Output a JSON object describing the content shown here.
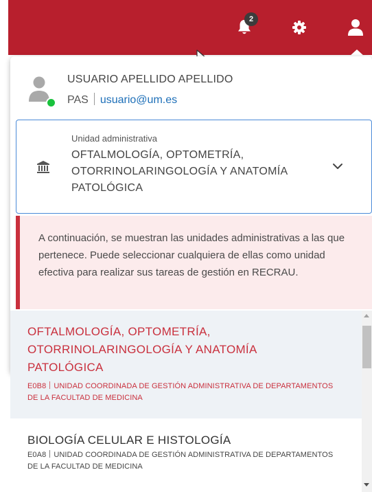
{
  "topbar": {
    "color": "#b81f2d",
    "notifications": {
      "icon": "bell-icon",
      "count": "2"
    },
    "settings": {
      "icon": "gear-icon"
    },
    "user": {
      "icon": "user-icon"
    }
  },
  "user": {
    "name": "USUARIO APELLIDO APELLIDO",
    "role": "PAS",
    "email": "usuario@um.es",
    "status_color": "#19c23d"
  },
  "unit_select": {
    "label": "Unidad administrativa",
    "value": "OFTALMOLOGÍA, OPTOMETRÍA, OTORRINOLARINGOLOGÍA Y ANATOMÍA PATOLÓGICA",
    "icon": "institution-icon",
    "toggle_icon": "chevron-down-icon"
  },
  "info": {
    "text": "A continuación, se muestran las unidades administrativas a las que pertenece. Puede seleccionar cualquiera de ellas como unidad efectiva para realizar sus tareas de gestión en RECRAU.",
    "accent": "#c9303d"
  },
  "units": [
    {
      "title": "OFTALMOLOGÍA, OPTOMETRÍA, OTORRINOLARINGOLOGÍA Y ANATOMÍA PATOLÓGICA",
      "code": "E0B8",
      "parent": "UNIDAD COORDINADA DE GESTIÓN ADMINISTRATIVA DE DEPARTAMENTOS DE LA FACULTAD DE MEDICINA",
      "selected": true
    },
    {
      "title": "BIOLOGÍA CELULAR E HISTOLOGÍA",
      "code": "E0A8",
      "parent": "UNIDAD COORDINADA DE GESTIÓN ADMINISTRATIVA DE DEPARTAMENTOS DE LA FACULTAD DE MEDICINA",
      "selected": false
    }
  ]
}
